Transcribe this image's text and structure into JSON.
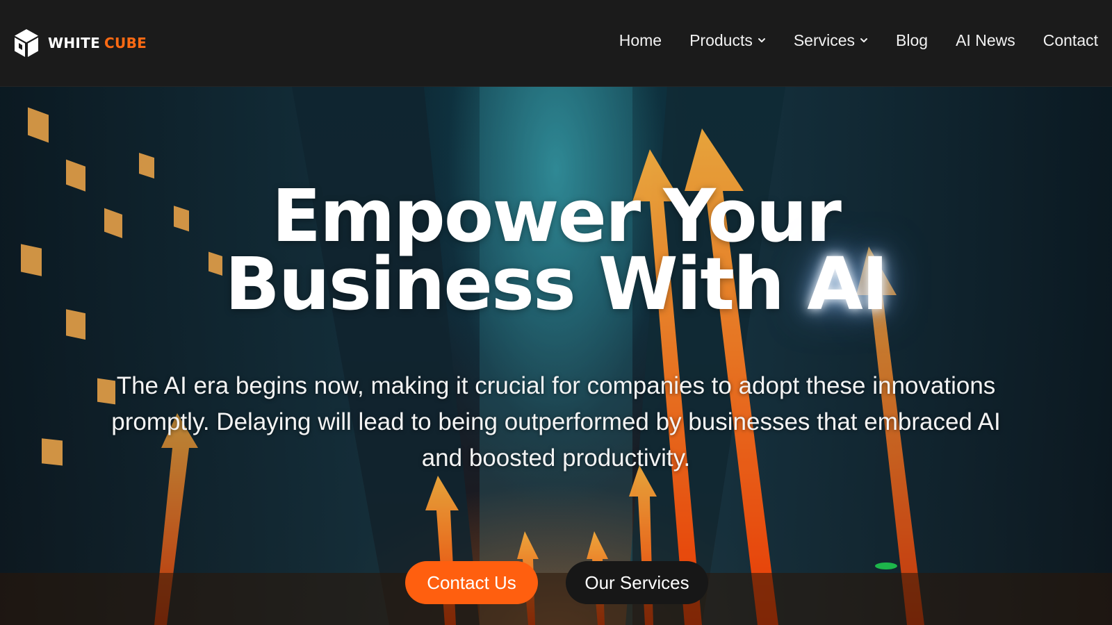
{
  "brand": {
    "name_primary": "WHITE",
    "name_accent": "CUBE",
    "accent_color": "#ff6a13",
    "logo_icon": "cube-icon"
  },
  "nav": {
    "items": [
      {
        "label": "Home",
        "has_dropdown": false
      },
      {
        "label": "Products",
        "has_dropdown": true
      },
      {
        "label": "Services",
        "has_dropdown": true
      },
      {
        "label": "Blog",
        "has_dropdown": false
      },
      {
        "label": "AI News",
        "has_dropdown": false
      },
      {
        "label": "Contact",
        "has_dropdown": false
      }
    ]
  },
  "hero": {
    "headline_line1": "Empower Your",
    "headline_line2_part1": "Business With",
    "headline_line2_glow": "AI",
    "subtext": "The AI era begins now, making it crucial for companies to adopt these innovations promptly. Delaying will lead to being outperformed by businesses that embraced AI and boosted productivity.",
    "primary_cta": "Contact Us",
    "secondary_cta": "Our Services",
    "primary_cta_color": "#ff5f0f",
    "secondary_cta_color": "#171717"
  }
}
